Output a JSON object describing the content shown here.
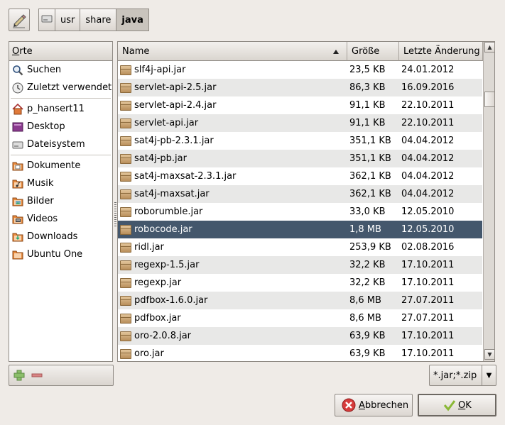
{
  "path": {
    "crumbs": [
      {
        "label": "",
        "icon": "harddisk-icon"
      },
      {
        "label": "usr"
      },
      {
        "label": "share"
      },
      {
        "label": "java",
        "active": true
      }
    ]
  },
  "places": {
    "header": "Orte",
    "header_mnemonic": "O",
    "header_rest": "rte",
    "groups": [
      [
        {
          "label": "Suchen",
          "icon": "search-icon"
        },
        {
          "label": "Zuletzt verwendet",
          "icon": "recent-icon"
        }
      ],
      [
        {
          "label": "p_hansert11",
          "icon": "home-icon"
        },
        {
          "label": "Desktop",
          "icon": "desktop-icon"
        },
        {
          "label": "Dateisystem",
          "icon": "filesystem-icon"
        }
      ],
      [
        {
          "label": "Dokumente",
          "icon": "documents-folder-icon"
        },
        {
          "label": "Musik",
          "icon": "music-folder-icon"
        },
        {
          "label": "Bilder",
          "icon": "pictures-folder-icon"
        },
        {
          "label": "Videos",
          "icon": "videos-folder-icon"
        },
        {
          "label": "Downloads",
          "icon": "downloads-folder-icon"
        },
        {
          "label": "Ubuntu One",
          "icon": "folder-icon"
        }
      ]
    ]
  },
  "files": {
    "columns": {
      "name": "Name",
      "size": "Größe",
      "date": "Letzte Änderung"
    },
    "sort": "name-ascending",
    "rows": [
      {
        "name": "slf4j-api.jar",
        "size": "23,5 KB",
        "date": "24.01.2012"
      },
      {
        "name": "servlet-api-2.5.jar",
        "size": "86,3 KB",
        "date": "16.09.2016"
      },
      {
        "name": "servlet-api-2.4.jar",
        "size": "91,1 KB",
        "date": "22.10.2011"
      },
      {
        "name": "servlet-api.jar",
        "size": "91,1 KB",
        "date": "22.10.2011"
      },
      {
        "name": "sat4j-pb-2.3.1.jar",
        "size": "351,1 KB",
        "date": "04.04.2012"
      },
      {
        "name": "sat4j-pb.jar",
        "size": "351,1 KB",
        "date": "04.04.2012"
      },
      {
        "name": "sat4j-maxsat-2.3.1.jar",
        "size": "362,1 KB",
        "date": "04.04.2012"
      },
      {
        "name": "sat4j-maxsat.jar",
        "size": "362,1 KB",
        "date": "04.04.2012"
      },
      {
        "name": "roborumble.jar",
        "size": "33,0 KB",
        "date": "12.05.2010"
      },
      {
        "name": "robocode.jar",
        "size": "1,8 MB",
        "date": "12.05.2010",
        "selected": true
      },
      {
        "name": "ridl.jar",
        "size": "253,9 KB",
        "date": "02.08.2016"
      },
      {
        "name": "regexp-1.5.jar",
        "size": "32,2 KB",
        "date": "17.10.2011"
      },
      {
        "name": "regexp.jar",
        "size": "32,2 KB",
        "date": "17.10.2011"
      },
      {
        "name": "pdfbox-1.6.0.jar",
        "size": "8,6 MB",
        "date": "27.07.2011"
      },
      {
        "name": "pdfbox.jar",
        "size": "8,6 MB",
        "date": "27.07.2011"
      },
      {
        "name": "oro-2.0.8.jar",
        "size": "63,9 KB",
        "date": "17.10.2011"
      },
      {
        "name": "oro.jar",
        "size": "63,9 KB",
        "date": "17.10.2011"
      }
    ]
  },
  "filter": {
    "value": "*.jar;*.zip"
  },
  "buttons": {
    "cancel": {
      "mnemonic": "A",
      "rest": "bbrechen"
    },
    "ok": {
      "mnemonic": "O",
      "rest": "K"
    }
  },
  "colors": {
    "selection": "#44576c",
    "row_alt": "#e8e8e7",
    "window_bg": "#efebe7"
  }
}
